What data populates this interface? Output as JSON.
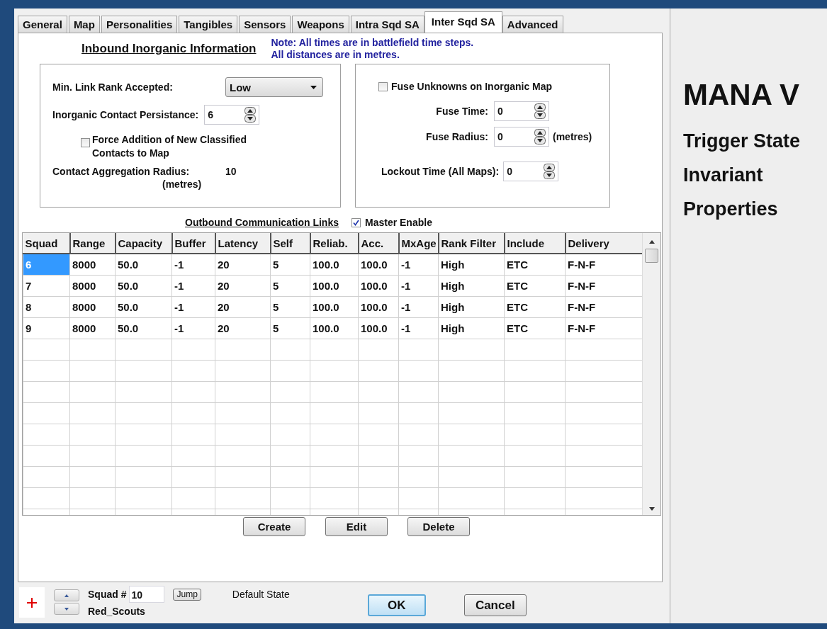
{
  "tabs": [
    {
      "label": "General",
      "selected": false
    },
    {
      "label": "Map",
      "selected": false
    },
    {
      "label": "Personalities",
      "selected": false
    },
    {
      "label": "Tangibles",
      "selected": false
    },
    {
      "label": "Sensors",
      "selected": false
    },
    {
      "label": "Weapons",
      "selected": false
    },
    {
      "label": "Intra Sqd SA",
      "selected": false
    },
    {
      "label": "Inter Sqd SA",
      "selected": true
    },
    {
      "label": "Advanced",
      "selected": false
    }
  ],
  "inbound": {
    "title": "Inbound Inorganic Information",
    "note": [
      "Note: All times are in battlefield time steps.",
      "All distances are in metres."
    ],
    "min_link_rank": {
      "label": "Min. Link Rank  Accepted:",
      "value": "Low"
    },
    "persistence": {
      "label": "Inorganic Contact Persistance:",
      "value": "6"
    },
    "force_addition": {
      "label": "Force Addition of New Classified Contacts to Map",
      "checked": false
    },
    "aggregation": {
      "label": "Contact Aggregation Radius:",
      "unit": "(metres)",
      "value": "10"
    }
  },
  "fuse": {
    "unknowns": {
      "label": "Fuse Unknowns on Inorganic Map",
      "checked": false
    },
    "fuse_time": {
      "label": "Fuse Time:",
      "value": "0"
    },
    "fuse_radius": {
      "label": "Fuse Radius:",
      "value": "0",
      "unit": "(metres)"
    },
    "lockout": {
      "label": "Lockout Time (All Maps):",
      "value": "0"
    }
  },
  "outbound": {
    "title": "Outbound Communication Links",
    "master_enable": {
      "label": "Master Enable",
      "checked": true
    }
  },
  "table": {
    "columns": [
      "Squad",
      "Range",
      "Capacity",
      "Buffer",
      "Latency",
      "Self",
      "Reliab.",
      "Acc.",
      "MxAge",
      "Rank Filter",
      "Include",
      "Delivery"
    ],
    "rows": [
      {
        "selected": true,
        "cells": [
          "6",
          "8000",
          "50.0",
          "-1",
          "20",
          "5",
          "100.0",
          "100.0",
          "-1",
          "High",
          "ETC",
          "F-N-F"
        ]
      },
      {
        "selected": false,
        "cells": [
          "7",
          "8000",
          "50.0",
          "-1",
          "20",
          "5",
          "100.0",
          "100.0",
          "-1",
          "High",
          "ETC",
          "F-N-F"
        ]
      },
      {
        "selected": false,
        "cells": [
          "8",
          "8000",
          "50.0",
          "-1",
          "20",
          "5",
          "100.0",
          "100.0",
          "-1",
          "High",
          "ETC",
          "F-N-F"
        ]
      },
      {
        "selected": false,
        "cells": [
          "9",
          "8000",
          "50.0",
          "-1",
          "20",
          "5",
          "100.0",
          "100.0",
          "-1",
          "High",
          "ETC",
          "F-N-F"
        ]
      }
    ]
  },
  "table_buttons": [
    "Create",
    "Edit",
    "Delete"
  ],
  "squad": {
    "label": "Squad #",
    "value": "10",
    "jump": "Jump",
    "name": "Red_Scouts",
    "state": "Default State"
  },
  "dialog_buttons": [
    {
      "label": "OK",
      "focused": true
    },
    {
      "label": "Cancel",
      "focused": false
    }
  ],
  "side_panel": {
    "title": "MANA V",
    "lines": [
      "Trigger State",
      "Invariant",
      "Properties"
    ]
  }
}
